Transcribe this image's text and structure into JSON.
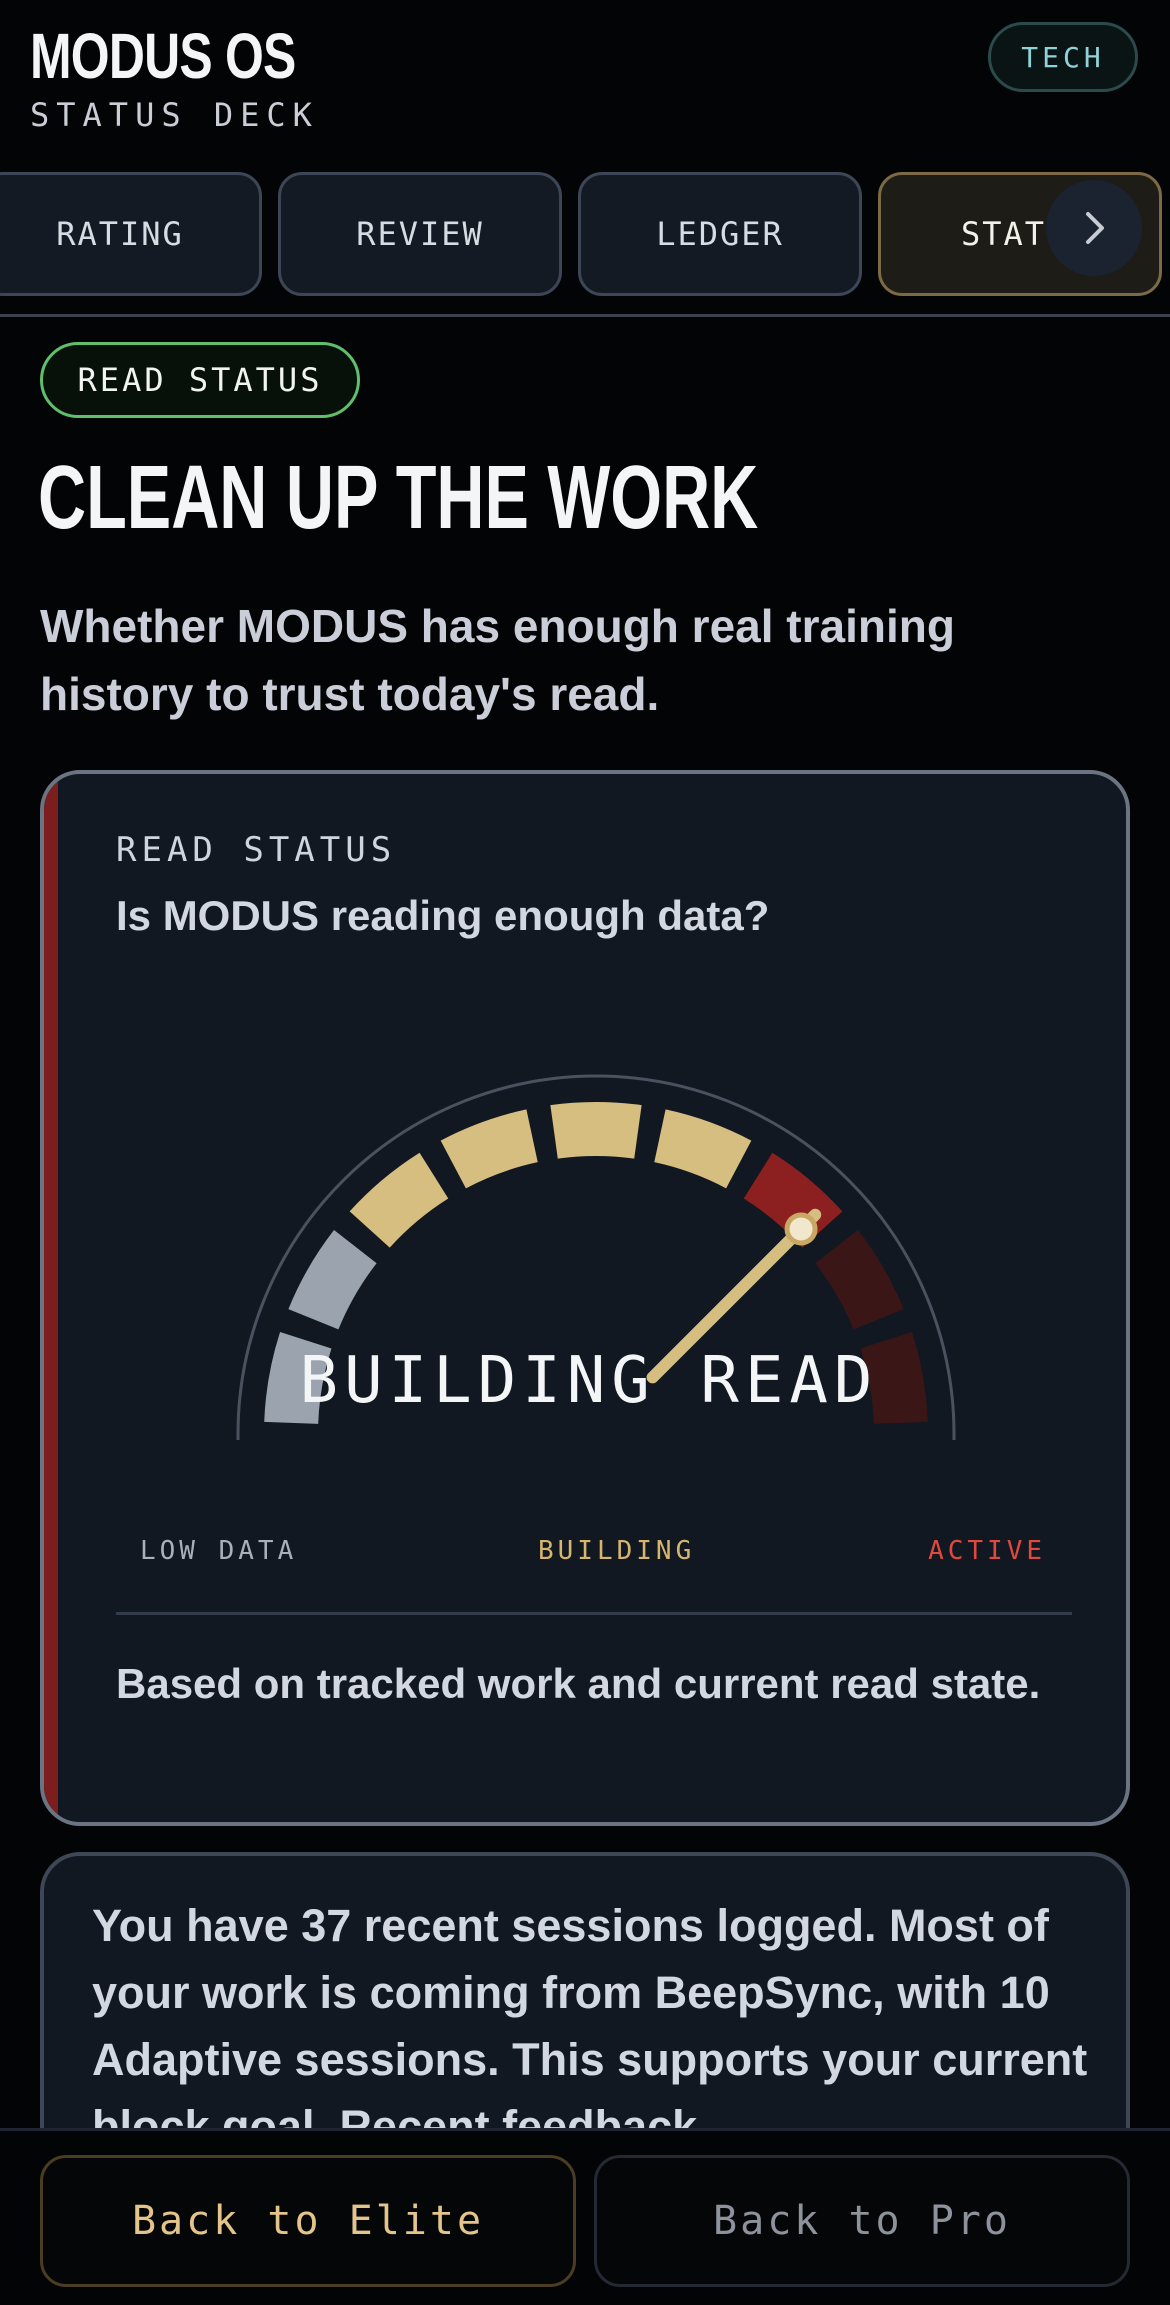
{
  "header": {
    "app_title": "MODUS OS",
    "subtitle": "STATUS DECK",
    "mode_pill": "TECH"
  },
  "tabs": [
    {
      "label": "RATING",
      "active": false
    },
    {
      "label": "REVIEW",
      "active": false
    },
    {
      "label": "LEDGER",
      "active": false
    },
    {
      "label": "STAT",
      "active": true
    }
  ],
  "section": {
    "badge": "READ STATUS",
    "title": "CLEAN UP THE WORK",
    "description": "Whether MODUS has enough real training history to trust today's read."
  },
  "gauge_card": {
    "kicker": "READ STATUS",
    "question": "Is MODUS reading enough data?",
    "state_label": "BUILDING READ",
    "needle_value": 0.75,
    "scale": {
      "low": "LOW DATA",
      "mid": "BUILDING",
      "high": "ACTIVE"
    },
    "footnote": "Based on tracked work and current read state.",
    "colors": {
      "low": "#9aa3ae",
      "building": "#d6bd80",
      "active": "#8c1f1f",
      "active_dim": "#3a1617",
      "accent": "#7c1e1e"
    }
  },
  "summary": {
    "text": "You have 37 recent sessions logged. Most of your work is coming from BeepSync, with 10 Adaptive sessions. This supports your current block goal. Recent feedback"
  },
  "bottom_bar": {
    "primary_label": "Back to Elite",
    "secondary_label": "Back to Pro"
  }
}
